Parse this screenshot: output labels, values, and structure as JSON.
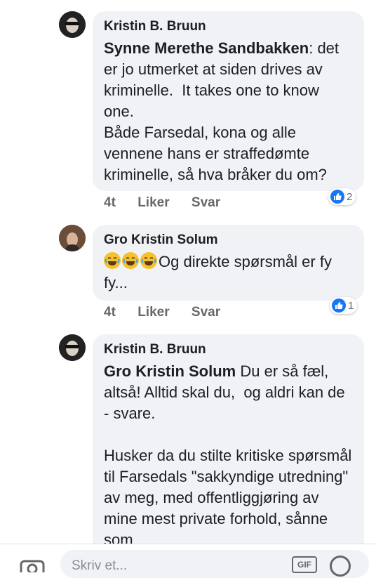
{
  "comments": [
    {
      "author": "Kristin B. Bruun",
      "mention": "Synne Merethe Sandbakken",
      "text": ": det er jo utmerket at siden drives av kriminelle.  It takes one to know one.\nBåde Farsedal, kona og alle vennene hans er straffedømte kriminelle, så hva bråker du om?",
      "time": "4t",
      "like_label": "Liker",
      "reply_label": "Svar",
      "reaction_count": "2"
    },
    {
      "author": "Gro Kristin Solum",
      "text": "Og direkte spørsmål er fy fy...",
      "emoji_count": 3,
      "time": "4t",
      "like_label": "Liker",
      "reply_label": "Svar",
      "reaction_count": "1"
    },
    {
      "author": "Kristin B. Bruun",
      "mention": "Gro Kristin Solum",
      "text": " Du er så fæl, altså! Alltid skal du,  og aldri kan de - svare.\n\nHusker da du stilte kritiske spørsmål til Farsedals \"sakkyndige utredning\" av meg, med offentliggjøring av mine mest private forhold, sånne som"
    }
  ],
  "composer": {
    "placeholder": "Skriv et...",
    "gif_label": "GIF"
  },
  "colors": {
    "bubble": "#f0f2f5",
    "like_blue": "#1877f2",
    "meta_gray": "#65676b"
  }
}
